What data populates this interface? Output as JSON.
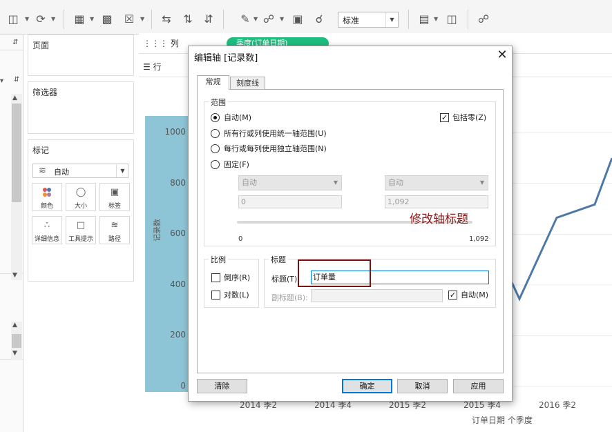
{
  "toolbar": {
    "fit_value": "标准"
  },
  "sidebar": {
    "pages_title": "页面",
    "filters_title": "筛选器",
    "marks_title": "标记",
    "marks_type": "自动",
    "marks_buttons": [
      {
        "label": "颜色",
        "icon": "color-icon"
      },
      {
        "label": "大小",
        "icon": "size-icon"
      },
      {
        "label": "标签",
        "icon": "label-icon"
      },
      {
        "label": "详细信息",
        "icon": "detail-icon"
      },
      {
        "label": "工具提示",
        "icon": "tooltip-icon"
      },
      {
        "label": "路径",
        "icon": "path-icon"
      }
    ]
  },
  "shelves": {
    "columns_label": "列",
    "rows_label": "行",
    "column_pill": "季度(订单日期)"
  },
  "chart_data": {
    "type": "line",
    "ylabel": "记录数",
    "xlabel": "订单日期 个季度",
    "y_ticks": [
      "1000",
      "800",
      "600",
      "400",
      "200",
      "0"
    ],
    "x_ticks": [
      "2014 季2",
      "2014 季4",
      "2015 季2",
      "2015 季4",
      "2016 季2"
    ],
    "line_color": "#4e79a7",
    "visible_series_points_y": [
      410,
      345,
      665,
      717,
      900
    ]
  },
  "dialog": {
    "title": "编辑轴 [记录数]",
    "tabs": [
      "常规",
      "刻度线"
    ],
    "range": {
      "group_title": "范围",
      "options": [
        "自动(M)",
        "所有行或列使用统一轴范围(U)",
        "每行或每列使用独立轴范围(N)",
        "固定(F)"
      ],
      "selected": 0,
      "include_zero_label": "包括零(Z)",
      "include_zero_checked": true,
      "start_select": "自动",
      "end_select": "自动",
      "start_value": "0",
      "end_value": "1,092",
      "slider_min": "0",
      "slider_max": "1,092"
    },
    "scale": {
      "group_title": "比例",
      "reversed_label": "倒序(R)",
      "log_label": "对数(L)"
    },
    "titles": {
      "group_title": "标题",
      "title_label": "标题(T):",
      "title_value": "订单量",
      "subtitle_label": "副标题(B):",
      "auto_label": "自动(M)",
      "auto_checked": true
    },
    "buttons": {
      "clear": "清除",
      "ok": "确定",
      "cancel": "取消",
      "apply": "应用"
    }
  },
  "annotation": {
    "text": "修改轴标题",
    "color": "#8b1a1a"
  }
}
